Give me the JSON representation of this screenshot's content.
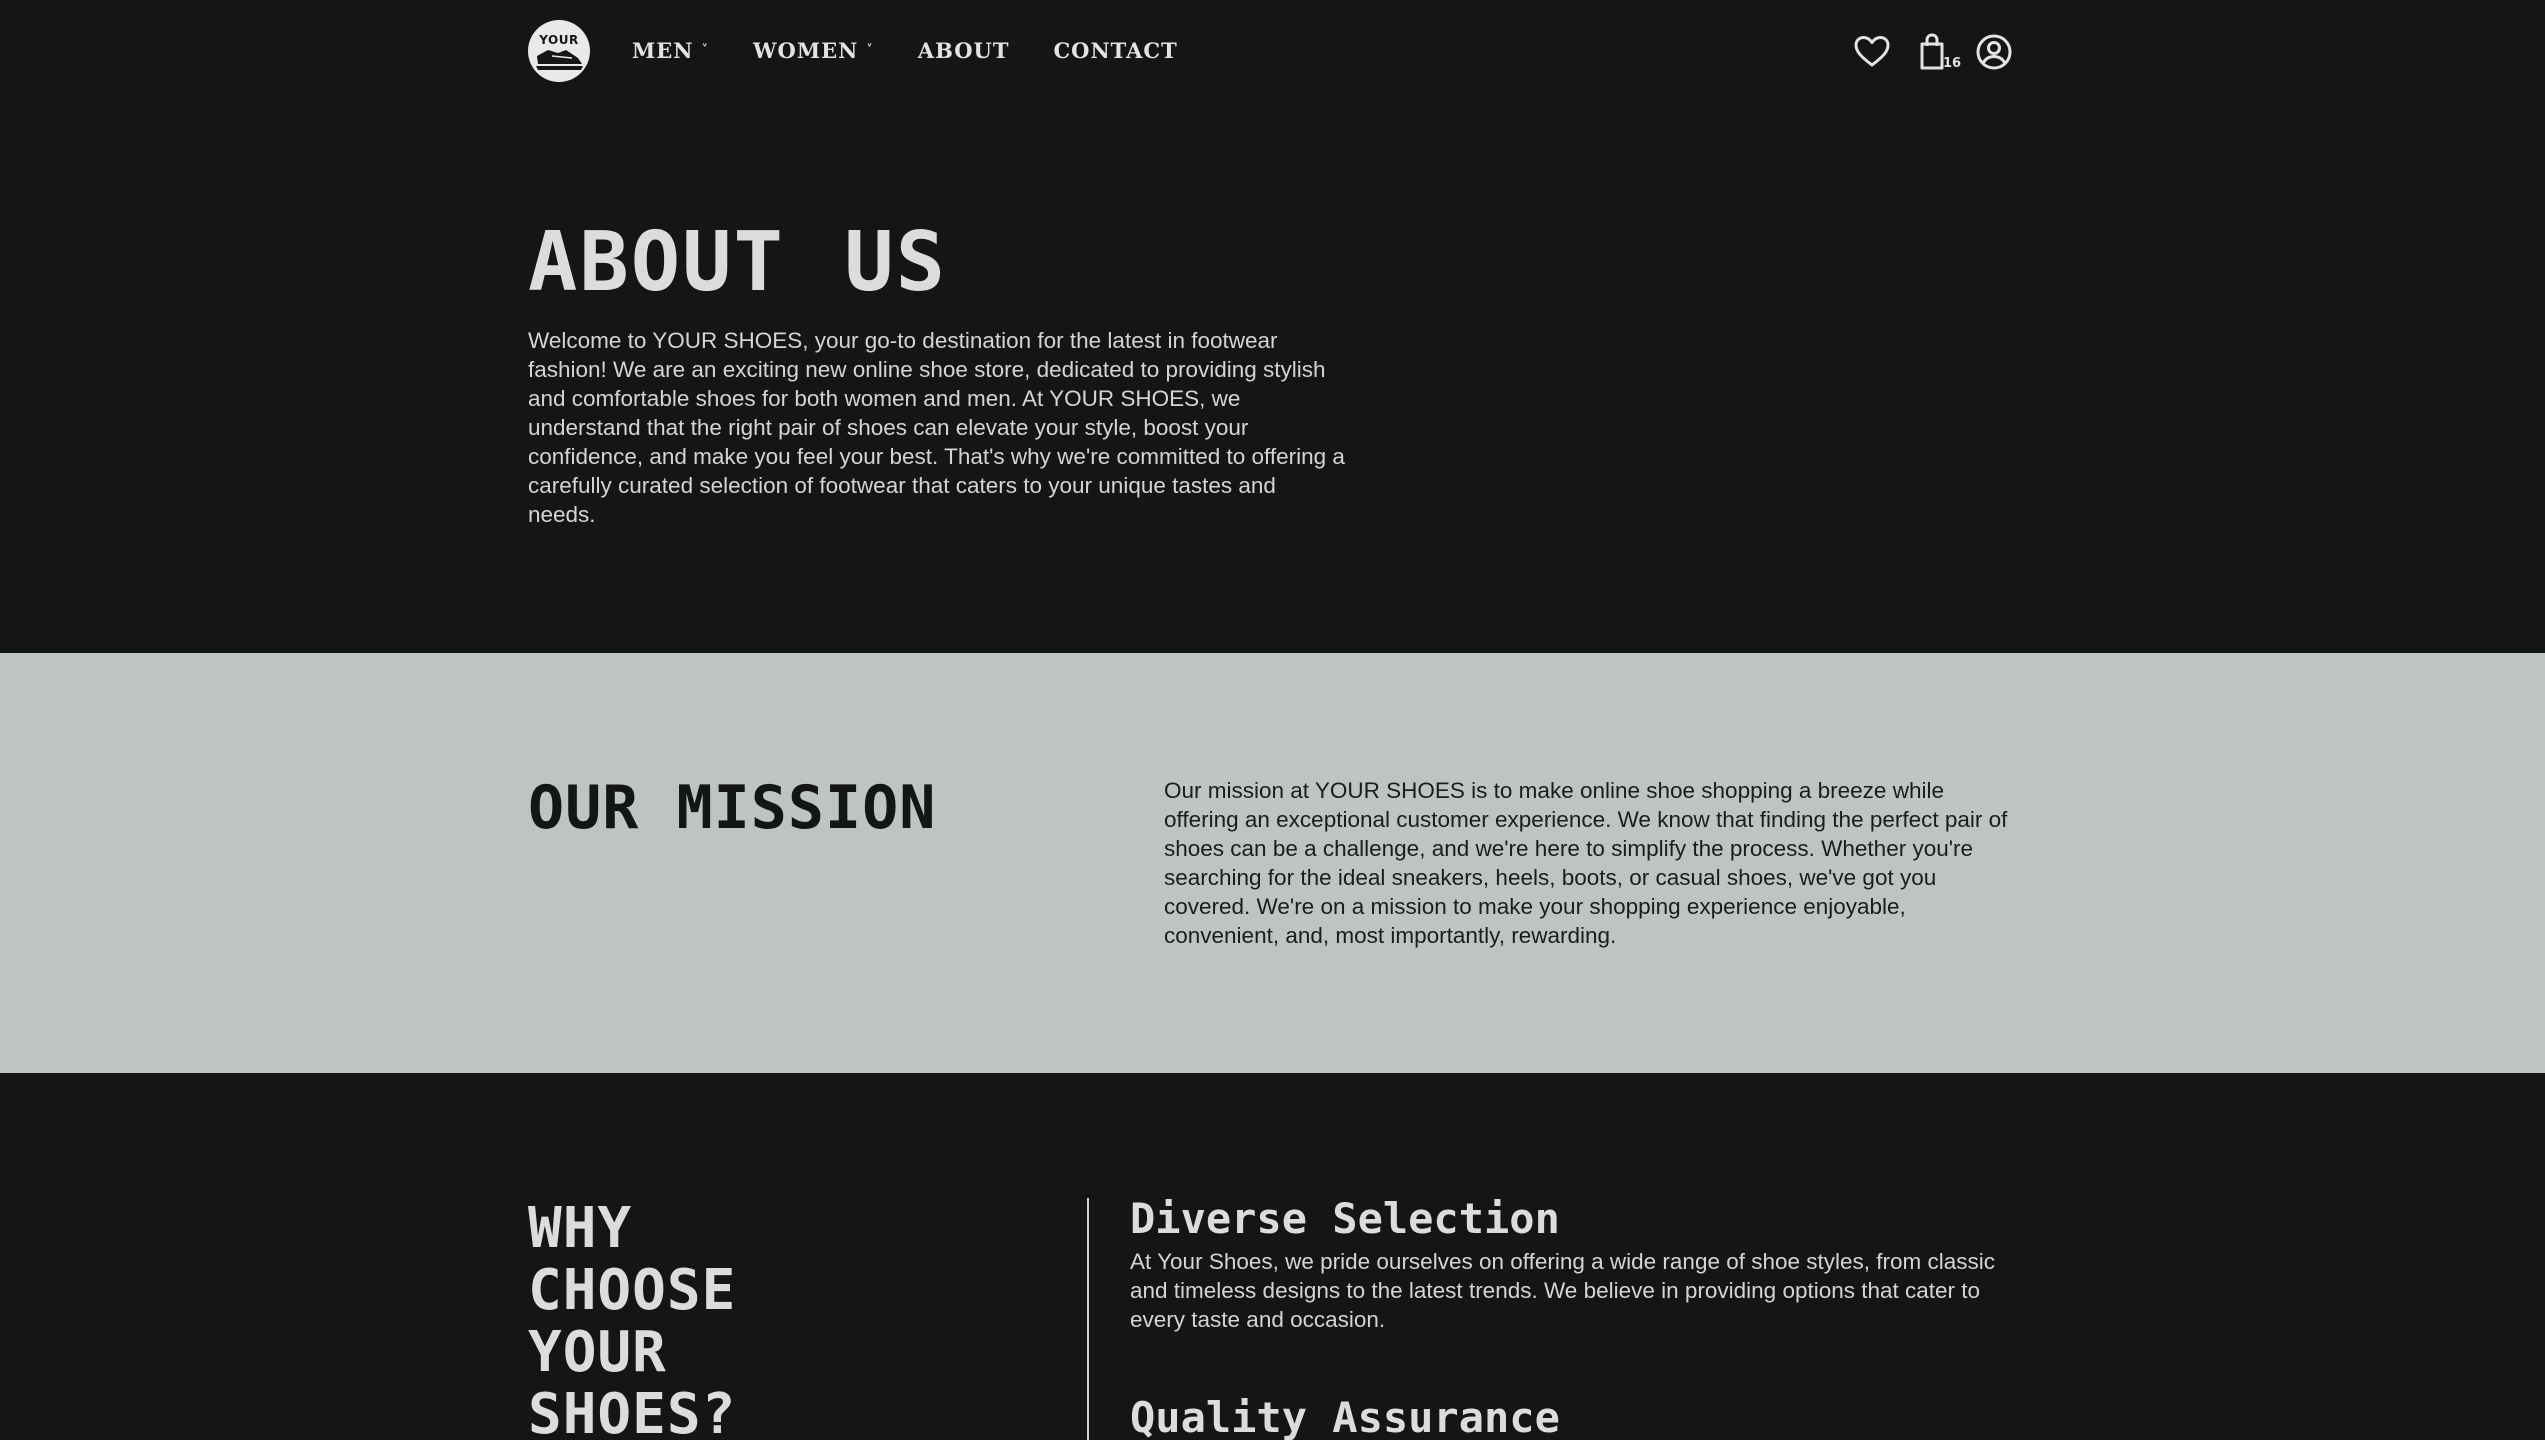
{
  "brand": {
    "logo_text": "YOUR"
  },
  "nav": {
    "items": [
      {
        "label": "MEN",
        "has_dropdown": true
      },
      {
        "label": "WOMEN",
        "has_dropdown": true
      },
      {
        "label": "ABOUT",
        "has_dropdown": false
      },
      {
        "label": "CONTACT",
        "has_dropdown": false
      }
    ],
    "dropdown_glyph": "˅"
  },
  "header_icons": {
    "wishlist": "heart-icon",
    "cart": "shopping-bag-icon",
    "cart_count": "16",
    "account": "user-icon"
  },
  "about": {
    "title": "ABOUT US",
    "text": "Welcome to YOUR SHOES, your go-to destination for the latest in footwear fashion! We are an exciting new online shoe store, dedicated to providing stylish and comfortable shoes for both women and men. At YOUR SHOES, we understand that the right pair of shoes can elevate your style, boost your confidence, and make you feel your best. That's why we're committed to offering a carefully curated selection of footwear that caters to your unique tastes and needs."
  },
  "mission": {
    "title": "OUR MISSION",
    "text": "Our mission at YOUR SHOES is to make online shoe shopping a breeze while offering an exceptional customer experience. We know that finding the perfect pair of shoes can be a challenge, and we're here to simplify the process. Whether you're searching for the ideal sneakers, heels, boots, or casual shoes, we've got you covered. We're on a mission to make your shopping experience enjoyable, convenient, and, most importantly, rewarding."
  },
  "why": {
    "title_lines": [
      "WHY",
      "CHOOSE",
      "YOUR",
      "SHOES?"
    ],
    "features": [
      {
        "title": "Diverse Selection",
        "text": "At Your Shoes, we pride ourselves on offering a wide range of shoe styles, from classic and timeless designs to the latest trends. We believe in providing options that cater to every taste and occasion."
      },
      {
        "title": "Quality Assurance",
        "text": ""
      }
    ]
  },
  "colors": {
    "background": "#141616",
    "mission_background": "#bec4c3",
    "text_light": "#dcdcdc",
    "text_dark": "#141616"
  }
}
